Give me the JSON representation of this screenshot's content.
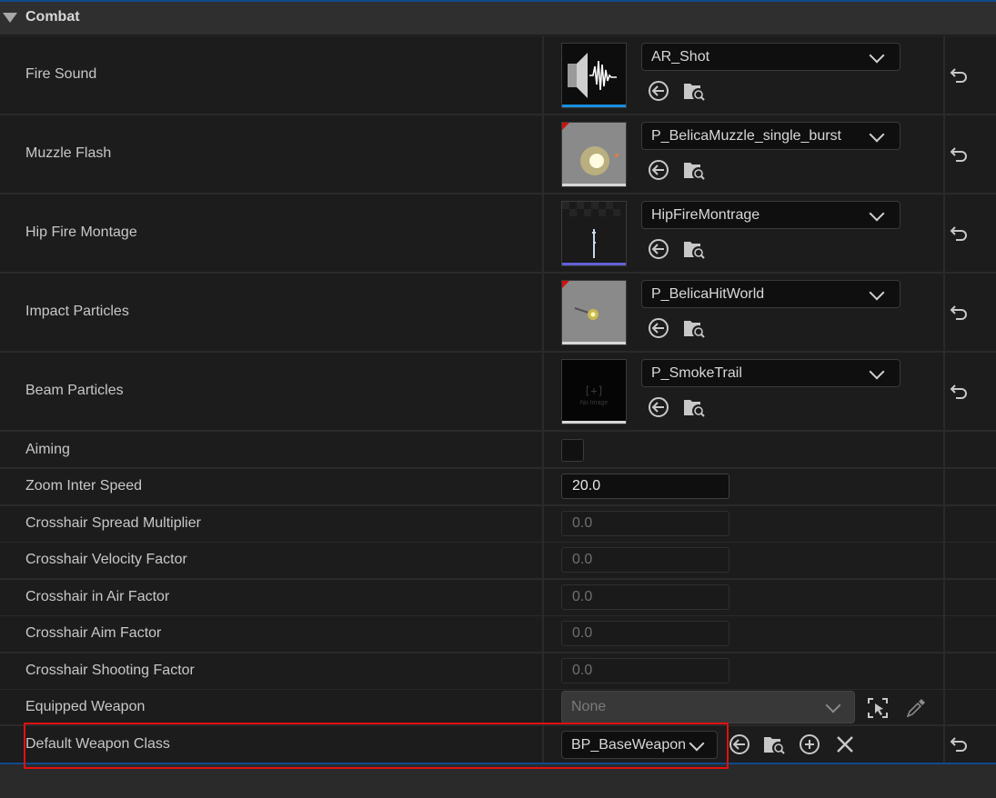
{
  "section": {
    "title": "Combat"
  },
  "asset_rows": [
    {
      "label": "Fire Sound",
      "value": "AR_Shot",
      "thumb_icon": "sound-wave-icon"
    },
    {
      "label": "Muzzle Flash",
      "value": "P_BelicaMuzzle_single_burst",
      "thumb_icon": "particle-flash-icon"
    },
    {
      "label": "Hip Fire Montage",
      "value": "HipFireMontrage",
      "thumb_icon": "animation-montage-icon"
    },
    {
      "label": "Impact Particles",
      "value": "P_BelicaHitWorld",
      "thumb_icon": "particle-hit-icon"
    },
    {
      "label": "Beam Particles",
      "value": "P_SmokeTrail",
      "thumb_icon": "no-image-icon"
    }
  ],
  "aiming": {
    "label": "Aiming"
  },
  "numeric_rows": [
    {
      "label": "Zoom Inter Speed",
      "value": "20.0"
    },
    {
      "label": "Crosshair Spread Multiplier",
      "value": "0.0"
    },
    {
      "label": "Crosshair Velocity Factor",
      "value": "0.0"
    },
    {
      "label": "Crosshair in Air Factor",
      "value": "0.0"
    },
    {
      "label": "Crosshair Aim Factor",
      "value": "0.0"
    },
    {
      "label": "Crosshair Shooting Factor",
      "value": "0.0"
    }
  ],
  "equipped_weapon": {
    "label": "Equipped Weapon",
    "value": "None"
  },
  "default_weapon_class": {
    "label": "Default Weapon Class",
    "value": "BP_BaseWeapon"
  },
  "thumb_text": {
    "no_image": "No Image"
  },
  "colors": {
    "highlight": "#e01010",
    "accent_blue": "#0f4a8a"
  }
}
